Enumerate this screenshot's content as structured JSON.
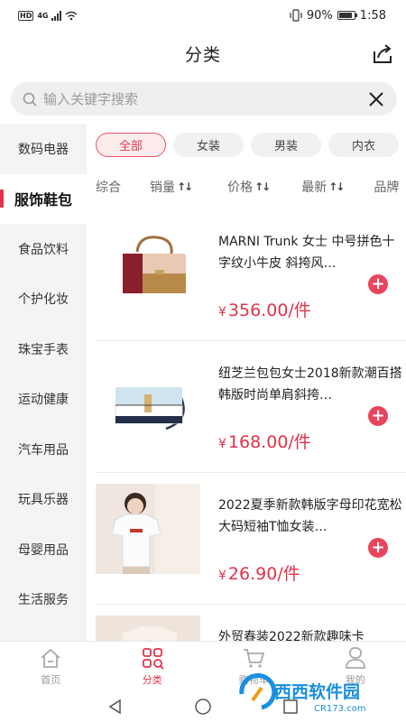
{
  "status_bar": {
    "network": "HD",
    "network_type": "4G",
    "battery": "90%",
    "battery_level": 0.9,
    "time": "1:58"
  },
  "header": {
    "title": "分类",
    "share_icon": "share-icon"
  },
  "search": {
    "placeholder": "输入关键字搜索",
    "search_icon": "search-icon",
    "clear_icon": "close-icon"
  },
  "sidebar": {
    "items": [
      {
        "label": "数码电器",
        "active": false
      },
      {
        "label": "服饰鞋包",
        "active": true
      },
      {
        "label": "食品饮料",
        "active": false
      },
      {
        "label": "个护化妆",
        "active": false
      },
      {
        "label": "珠宝手表",
        "active": false
      },
      {
        "label": "运动健康",
        "active": false
      },
      {
        "label": "汽车用品",
        "active": false
      },
      {
        "label": "玩具乐器",
        "active": false
      },
      {
        "label": "母婴用品",
        "active": false
      },
      {
        "label": "生活服务",
        "active": false
      }
    ]
  },
  "chips": [
    {
      "label": "全部",
      "active": true
    },
    {
      "label": "女装",
      "active": false
    },
    {
      "label": "男装",
      "active": false
    },
    {
      "label": "内衣",
      "active": false
    }
  ],
  "sort": [
    {
      "label": "综合",
      "arrow": ""
    },
    {
      "label": "销量",
      "arrow": "↑↓"
    },
    {
      "label": "价格",
      "arrow": "↑↓"
    },
    {
      "label": "最新",
      "arrow": "↑↓"
    },
    {
      "label": "品牌",
      "arrow": ""
    }
  ],
  "products": [
    {
      "title": "MARNI Trunk 女士 中号拼色十字纹小牛皮 斜挎风…",
      "currency": "¥",
      "price": "356.00/件",
      "image": "handbag-image"
    },
    {
      "title": "纽芝兰包包女士2018新款潮百搭韩版时尚单肩斜挎…",
      "currency": "¥",
      "price": "168.00/件",
      "image": "crossbody-bag-image"
    },
    {
      "title": "2022夏季新款韩版字母印花宽松大码短袖T恤女装…",
      "currency": "¥",
      "price": "26.90/件",
      "image": "tshirt-model-image"
    },
    {
      "title": "外贸春装2022新款趣味卡",
      "currency": "",
      "price": "",
      "image": "clothing-image"
    }
  ],
  "tabs": [
    {
      "label": "首页",
      "icon": "home-icon",
      "active": false
    },
    {
      "label": "分类",
      "icon": "category-icon",
      "active": true
    },
    {
      "label": "购物车",
      "icon": "cart-icon",
      "active": false
    },
    {
      "label": "我的",
      "icon": "user-icon",
      "active": false
    }
  ],
  "watermark": {
    "text": "西西软件园",
    "sub": "CR173.com"
  },
  "colors": {
    "accent": "#e0334b",
    "sidebar_bg": "#f4f4f4",
    "chip_bg": "#f1f1f1"
  }
}
